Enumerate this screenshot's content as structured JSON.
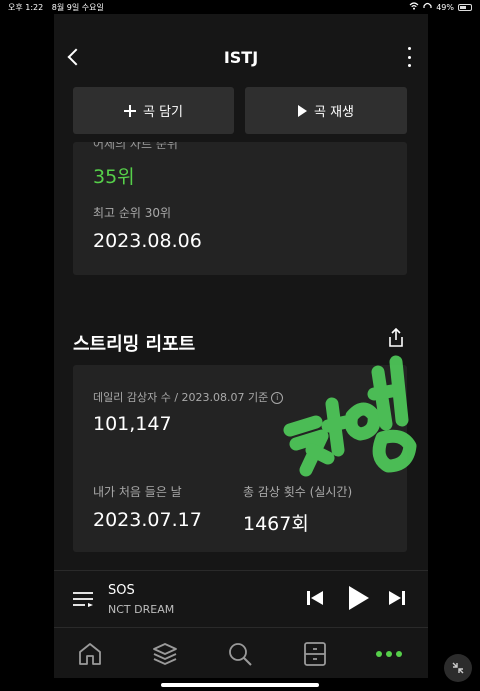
{
  "status_bar": {
    "time": "오후 1:22",
    "date": "8월 9일 수요일",
    "battery": "49%"
  },
  "header": {
    "title": "ISTJ"
  },
  "actions": {
    "add_label": "곡 담기",
    "play_label": "곡 재생"
  },
  "chart_card": {
    "yesterday_label": "어제의 차트 순위",
    "yesterday_rank": "35위",
    "peak_label": "최고 순위 30위",
    "peak_date": "2023.08.06"
  },
  "report": {
    "section_title": "스트리밍 리포트",
    "daily_label": "데일리 감상자 수 / 2023.08.07 기준",
    "daily_value": "101,147",
    "first_listen_label": "내가 처음 들은 날",
    "first_listen_value": "2023.07.17",
    "total_plays_label": "총 감상 횟수 (실시간)",
    "total_plays_value": "1467회"
  },
  "sticker": {
    "text": "찍었음"
  },
  "mini_player": {
    "song_title": "SOS",
    "artist": "NCT DREAM"
  },
  "tabs": [
    {
      "icon": "home-icon"
    },
    {
      "icon": "library-icon"
    },
    {
      "icon": "search-icon"
    },
    {
      "icon": "storage-icon"
    },
    {
      "icon": "more-dots-icon"
    }
  ],
  "colors": {
    "accent_green": "#56d04a",
    "background": "#161616",
    "card": "#232323",
    "button": "#2f2f2f"
  }
}
